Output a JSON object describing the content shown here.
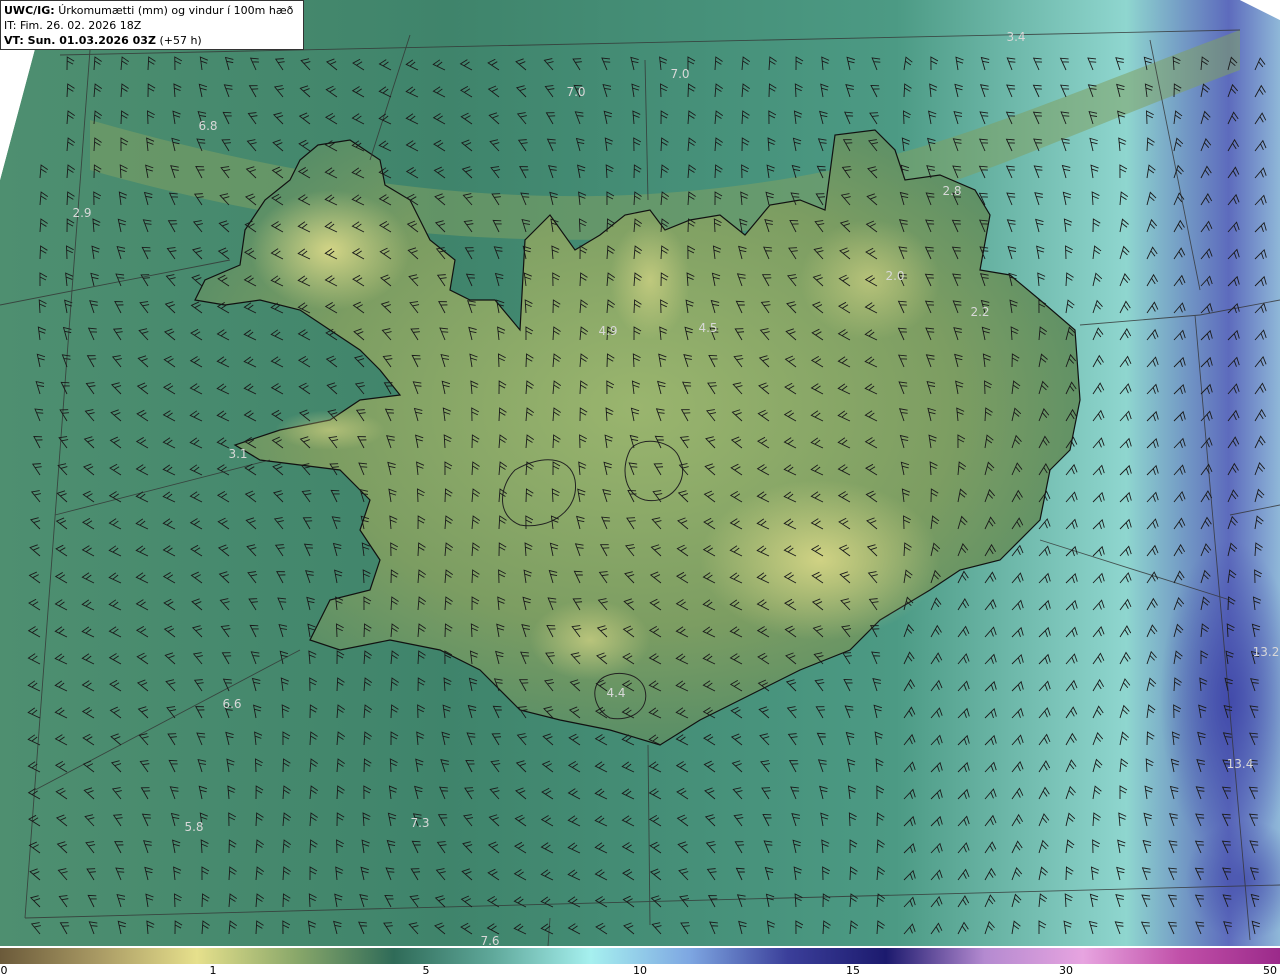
{
  "header": {
    "model_label": "UWC/IG:",
    "field_description": "Úrkomumætti (mm) og vindur í 100m hæð",
    "init_time": "IT: Fim. 26. 02. 2026 18Z",
    "valid_prefix": "VT: Sun. 01.03.2026 03Z",
    "valid_offset": "(+57 h)"
  },
  "map_labels": [
    "3.4",
    "7.0",
    "7.0",
    "6.8",
    "2.9",
    "2.8",
    "2.0",
    "2.2",
    "4.9",
    "4.5",
    "3.1",
    "13.2",
    "13.4",
    "6.6",
    "5.8",
    "7.3",
    "7.6",
    "4.4"
  ],
  "colorbar": {
    "ticks": [
      "0",
      "1",
      "5",
      "10",
      "15",
      "30",
      "50"
    ],
    "stops": [
      "#6b5a3a",
      "#a99a64",
      "#e6e08c",
      "#8aa86a",
      "#2f6b58",
      "#5fa89a",
      "#a6f0ef",
      "#7ea7e2",
      "#3b3f9a",
      "#1c1a6e",
      "#b48ad0",
      "#e7a4e0",
      "#c04fa8",
      "#9b2a8a"
    ]
  },
  "chart_data": {
    "type": "heatmap",
    "title": "Úrkomumætti (mm) og vindur í 100m hæð",
    "legend_ticks": [
      0,
      1,
      5,
      10,
      15,
      30,
      50
    ],
    "point_values": [
      3.4,
      7.0,
      7.0,
      6.8,
      2.9,
      2.8,
      2.0,
      2.2,
      4.9,
      4.5,
      3.1,
      13.2,
      13.4,
      6.6,
      5.8,
      7.3,
      7.6,
      4.4
    ]
  }
}
